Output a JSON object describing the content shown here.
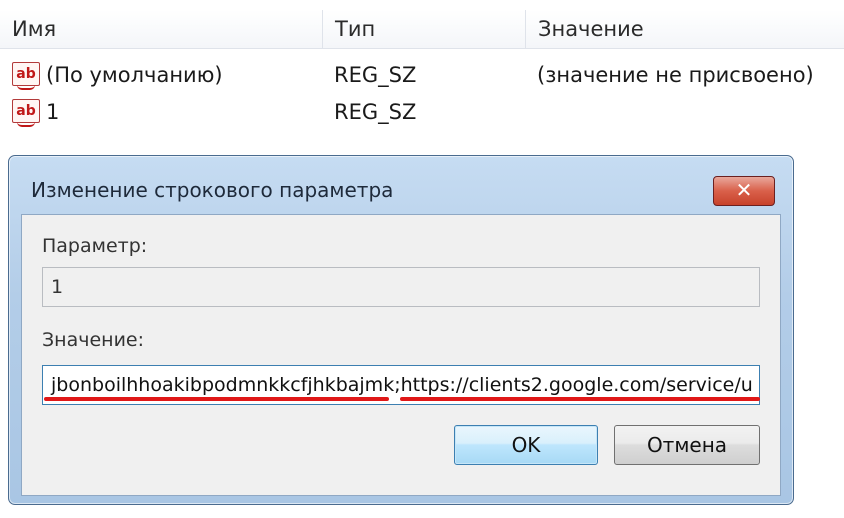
{
  "registry": {
    "columns": [
      "Имя",
      "Тип",
      "Значение"
    ],
    "rows": [
      {
        "name": "(По умолчанию)",
        "type": "REG_SZ",
        "value": "(значение не присвоено)",
        "icon": "string-value-icon"
      },
      {
        "name": "1",
        "type": "REG_SZ",
        "value": "",
        "icon": "string-value-icon"
      }
    ]
  },
  "dialog": {
    "title": "Изменение строкового параметра",
    "close_label": "✕",
    "param_label": "Параметр:",
    "param_value": "1",
    "value_label": "Значение:",
    "value_text": "jbonboilhhoakibpodmnkkcfjhkbajmk;https://clients2.google.com/service/u",
    "ok_label": "OK",
    "cancel_label": "Отмена",
    "underline_color": "#e01818"
  }
}
